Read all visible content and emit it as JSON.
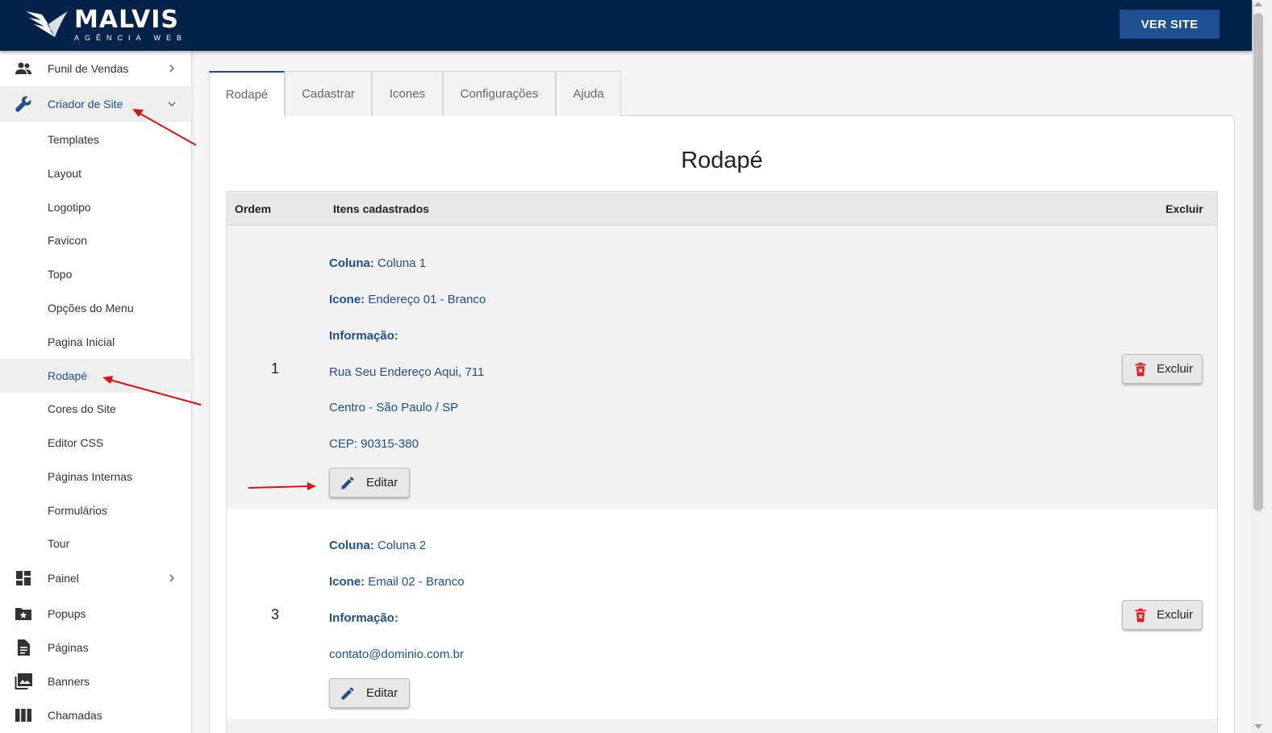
{
  "header": {
    "logo_main": "MALVIS",
    "logo_sub": "AGÊNCIA  WEB",
    "ver_site_label": "VER SITE",
    "bg_color": "#03224a",
    "accent_color": "#1e4f92"
  },
  "sidebar": {
    "items": [
      {
        "label": "Funil de Vendas",
        "icon": "people-icon"
      },
      {
        "label": "Criador de Site",
        "icon": "wrench-icon"
      },
      {
        "label": "Painel",
        "icon": "dashboard-icon"
      },
      {
        "label": "Popups",
        "icon": "folder-star-icon"
      },
      {
        "label": "Páginas",
        "icon": "document-icon"
      },
      {
        "label": "Banners",
        "icon": "photo-library-icon"
      },
      {
        "label": "Chamadas",
        "icon": "columns-icon"
      }
    ],
    "sub_items": [
      "Templates",
      "Layout",
      "Logotipo",
      "Favicon",
      "Topo",
      "Opções do Menu",
      "Pagina Inicial",
      "Rodapé",
      "Cores do Site",
      "Editor CSS",
      "Páginas Internas",
      "Formulários",
      "Tour"
    ]
  },
  "tabs": [
    "Rodapé",
    "Cadastrar",
    "Icones",
    "Configurações",
    "Ajuda"
  ],
  "page_title": "Rodapé",
  "table": {
    "headers": {
      "order": "Ordem",
      "items": "Itens cadastrados",
      "delete": "Excluir"
    },
    "rows": [
      {
        "order": "1",
        "coluna_label": "Coluna:",
        "coluna_value": "Coluna 1",
        "icone_label": "Icone:",
        "icone_value": "Endereço 01 - Branco",
        "info_label": "Informação:",
        "info_lines": [
          "Rua Seu Endereço Aqui, 711",
          "Centro - São Paulo / SP",
          "CEP: 90315-380"
        ],
        "edit_label": "Editar",
        "delete_label": "Excluir"
      },
      {
        "order": "3",
        "coluna_label": "Coluna:",
        "coluna_value": "Coluna 2",
        "icone_label": "Icone:",
        "icone_value": "Email 02 - Branco",
        "info_label": "Informação:",
        "info_lines": [
          "contato@dominio.com.br"
        ],
        "edit_label": "Editar",
        "delete_label": "Excluir"
      }
    ]
  }
}
